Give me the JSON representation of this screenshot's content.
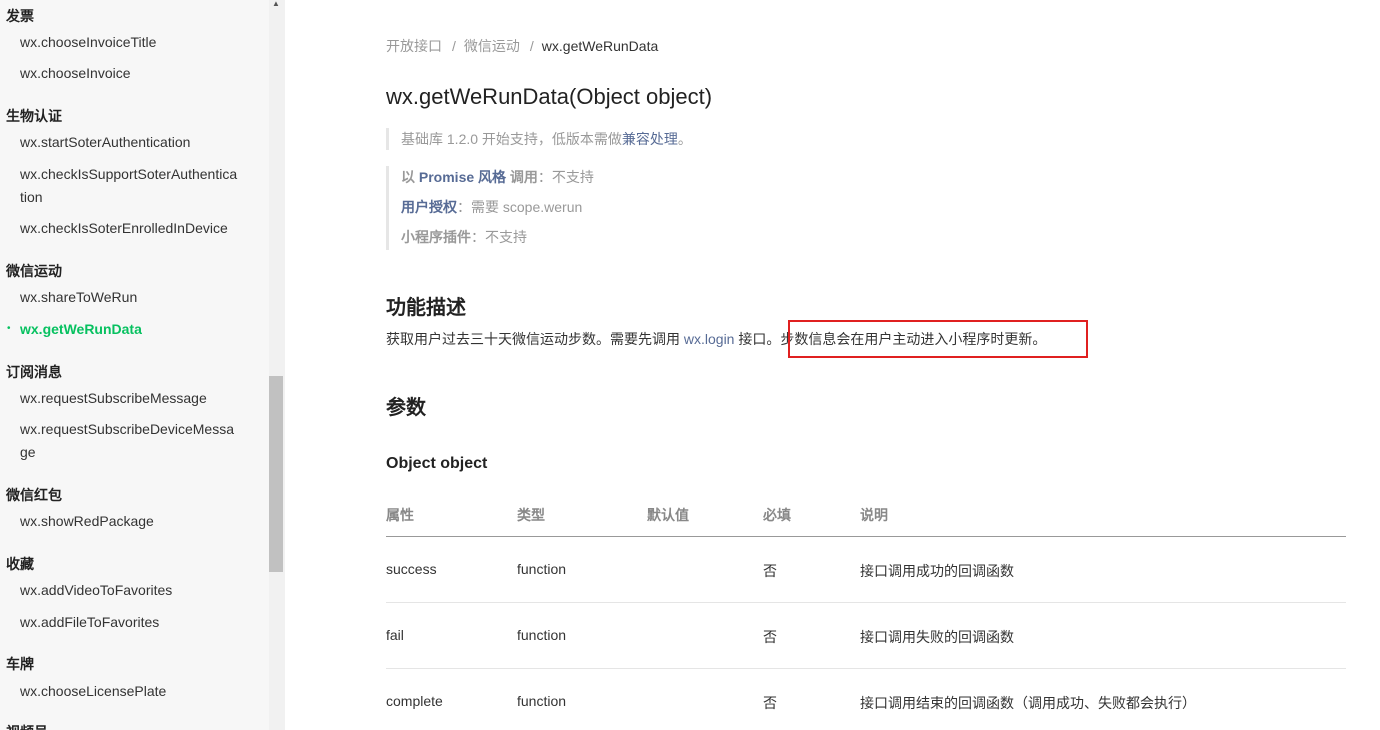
{
  "sidebar": {
    "groups": [
      {
        "title": "发票",
        "items": [
          "wx.chooseInvoiceTitle",
          "wx.chooseInvoice"
        ]
      },
      {
        "title": "生物认证",
        "items": [
          "wx.startSoterAuthentication",
          "wx.checkIsSupportSoterAuthentication",
          "wx.checkIsSoterEnrolledInDevice"
        ]
      },
      {
        "title": "微信运动",
        "items": [
          "wx.shareToWeRun",
          "wx.getWeRunData"
        ]
      },
      {
        "title": "订阅消息",
        "items": [
          "wx.requestSubscribeMessage",
          "wx.requestSubscribeDeviceMessage"
        ]
      },
      {
        "title": "微信红包",
        "items": [
          "wx.showRedPackage"
        ]
      },
      {
        "title": "收藏",
        "items": [
          "wx.addVideoToFavorites",
          "wx.addFileToFavorites"
        ]
      },
      {
        "title": "车牌",
        "items": [
          "wx.chooseLicensePlate"
        ]
      },
      {
        "title": "视频号",
        "items": []
      }
    ],
    "active_item": "wx.getWeRunData",
    "active_bullet": "•"
  },
  "breadcrumb": [
    "开放接口",
    "微信运动",
    "wx.getWeRunData"
  ],
  "breadcrumb_sep": "/",
  "title": "wx.getWeRunData(Object object)",
  "support": {
    "prefix": "基础库 1.2.0 开始支持，低版本需做",
    "link": "兼容处理",
    "suffix": "。"
  },
  "meta": {
    "promise_label_1": "以 ",
    "promise_label_2": "Promise 风格",
    "promise_label_3": " 调用",
    "promise_value": "：不支持",
    "auth_label": "用户授权",
    "auth_value": "：需要 scope.werun",
    "plugin_label": "小程序插件",
    "plugin_value": "：不支持"
  },
  "section_desc": {
    "heading": "功能描述",
    "text_before": "获取用户过去三十天微信运动步数。需要先调用 ",
    "link": "wx.login",
    "text_middle": " 接口。",
    "highlighted": "步数信息会在用户主动进入小程序时更新。"
  },
  "section_params": {
    "heading": "参数",
    "object_heading": "Object object"
  },
  "table": {
    "headers": [
      "属性",
      "类型",
      "默认值",
      "必填",
      "说明"
    ],
    "rows": [
      [
        "success",
        "function",
        "",
        "否",
        "接口调用成功的回调函数"
      ],
      [
        "fail",
        "function",
        "",
        "否",
        "接口调用失败的回调函数"
      ],
      [
        "complete",
        "function",
        "",
        "否",
        "接口调用结束的回调函数（调用成功、失败都会执行）"
      ]
    ]
  },
  "colors": {
    "accent": "#07c160",
    "link": "#576b95",
    "highlight_border": "#e02020"
  },
  "icons": {
    "scroll_up": "scroll-up-arrow-icon"
  }
}
